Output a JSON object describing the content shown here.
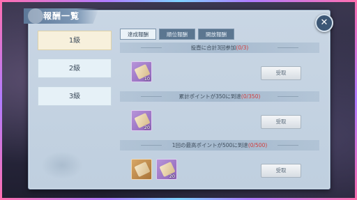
{
  "window": {
    "title": "報酬一覧",
    "close_label": "✕"
  },
  "levels": [
    {
      "label": "1級",
      "state": "active"
    },
    {
      "label": "2級",
      "state": "normal"
    },
    {
      "label": "3級",
      "state": "normal"
    }
  ],
  "tabs": [
    {
      "label": "達成報酬",
      "state": "active"
    },
    {
      "label": "順位報酬",
      "state": "inactive"
    },
    {
      "label": "開放報酬",
      "state": "inactive"
    }
  ],
  "rewards": [
    {
      "requirement": "投壺に合計3回参加",
      "progress": "(0/3)",
      "items": [
        {
          "color": "purple",
          "count": "10"
        }
      ],
      "button": "受取"
    },
    {
      "requirement": "累計ポイントが350に到達",
      "progress": "(0/350)",
      "items": [
        {
          "color": "purple",
          "count": "20"
        }
      ],
      "button": "受取"
    },
    {
      "requirement": "1回の最高ポイントが500に到達",
      "progress": "(0/500)",
      "items": [
        {
          "color": "orange",
          "count": ""
        },
        {
          "color": "purple",
          "count": "20"
        }
      ],
      "button": "受取"
    }
  ],
  "colors": {
    "progress": "#d23b3b",
    "panel": "#c9d6e4",
    "tab_active": "#eaf2f8",
    "tab_inactive": "#5b7690"
  }
}
